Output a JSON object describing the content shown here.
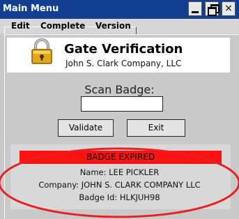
{
  "window": {
    "title": "Main Menu",
    "minimize_icon": "minimize-icon",
    "maximize_icon": "restore-icon",
    "close_label": "×"
  },
  "menu": {
    "items": [
      {
        "label": "Edit"
      },
      {
        "label": "Complete"
      },
      {
        "label": "Version"
      }
    ]
  },
  "header": {
    "icon": "padlock-icon",
    "title": "Gate Verification",
    "company": "John S. Clark Company, LLC"
  },
  "scan": {
    "label": "Scan Badge:",
    "value": ""
  },
  "buttons": {
    "validate_label": "Validate",
    "exit_label": "Exit"
  },
  "result": {
    "banner": "BADGE EXPIRED",
    "name_line": "Name: LEE PICKLER",
    "company_line": "Company: JOHN S. CLARK COMPANY LLC",
    "badge_line": "Badge Id: HLKJUH98",
    "banner_color": "#ff1212",
    "highlight_color": "#e82020"
  },
  "colors": {
    "titlebar": "#123f8f",
    "background": "#c9c9c9"
  }
}
